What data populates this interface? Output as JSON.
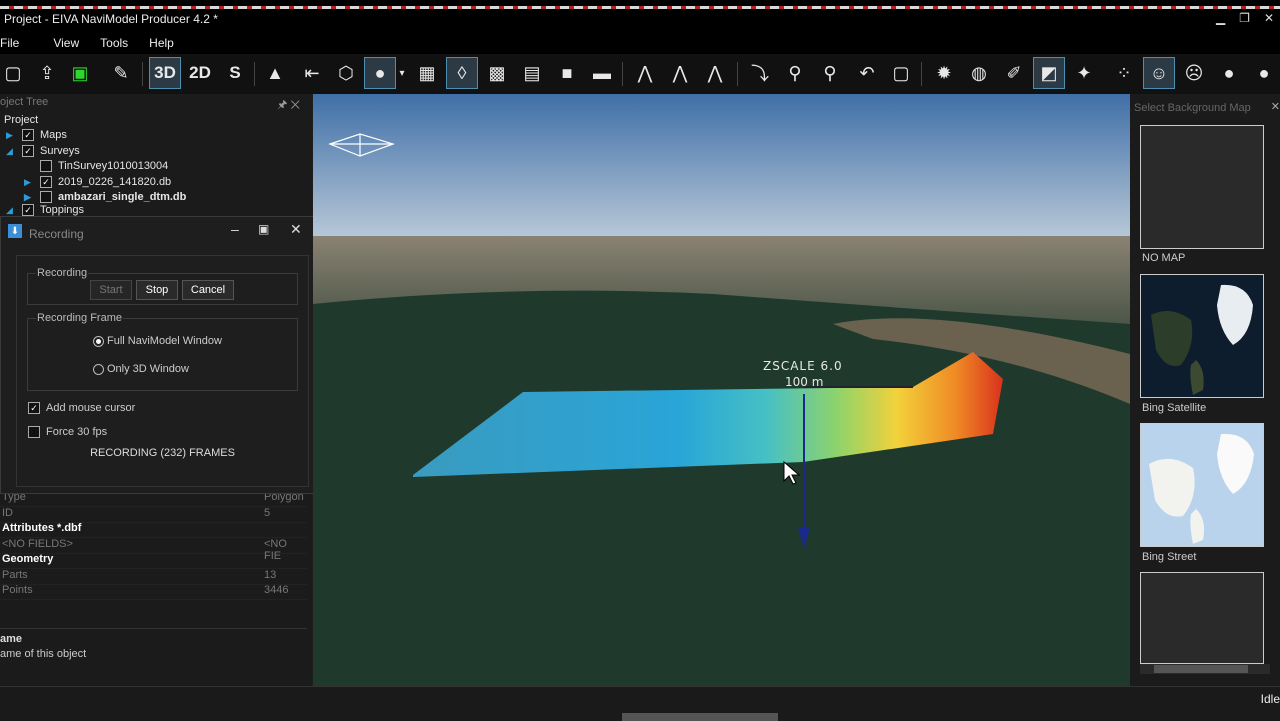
{
  "window": {
    "title": "Project - EIVA NaviModel Producer 4.2 *"
  },
  "menu": [
    "File",
    "View",
    "Tools",
    "Help"
  ],
  "toolbar": {
    "btn_3d": "3D",
    "btn_2d": "2D",
    "btn_s": "S"
  },
  "project_tree": {
    "panel_title": "oject Tree",
    "items": [
      {
        "label": "Project"
      },
      {
        "label": "Maps"
      },
      {
        "label": "Surveys"
      },
      {
        "label": "TinSurvey1010013004"
      },
      {
        "label": "2019_0226_141820.db"
      },
      {
        "label": "ambazari_single_dtm.db"
      },
      {
        "label": "Toppings"
      }
    ]
  },
  "recording_dialog": {
    "title": "Recording",
    "group_recording": "Recording",
    "start": "Start",
    "stop": "Stop",
    "cancel": "Cancel",
    "group_frame": "Recording Frame",
    "opt_full": "Full NaviModel Window",
    "opt_3d": "Only 3D Window",
    "add_mouse": "Add mouse cursor",
    "force_30": "Force 30 fps",
    "status": "RECORDING (232) FRAMES"
  },
  "properties": {
    "type_key": "Type",
    "type_val": "Polygon",
    "id_key": "ID",
    "id_val": "5",
    "attributes_header": "Attributes *.dbf",
    "nofields_key": "<NO FIELDS>",
    "nofields_val": "<NO FIE",
    "geometry_header": "Geometry",
    "parts_key": "Parts",
    "parts_val": "13",
    "points_key": "Points",
    "points_val": "3446"
  },
  "description": {
    "title": "ame",
    "text": "ame of this object"
  },
  "view3d": {
    "zscale": "ZSCALE 6.0",
    "scale": "100 m"
  },
  "background_maps": {
    "title": "Select Background Map",
    "maps": [
      {
        "label": "NO MAP"
      },
      {
        "label": "Bing Satellite"
      },
      {
        "label": "Bing Street"
      }
    ]
  },
  "status": {
    "text": "Idle"
  }
}
